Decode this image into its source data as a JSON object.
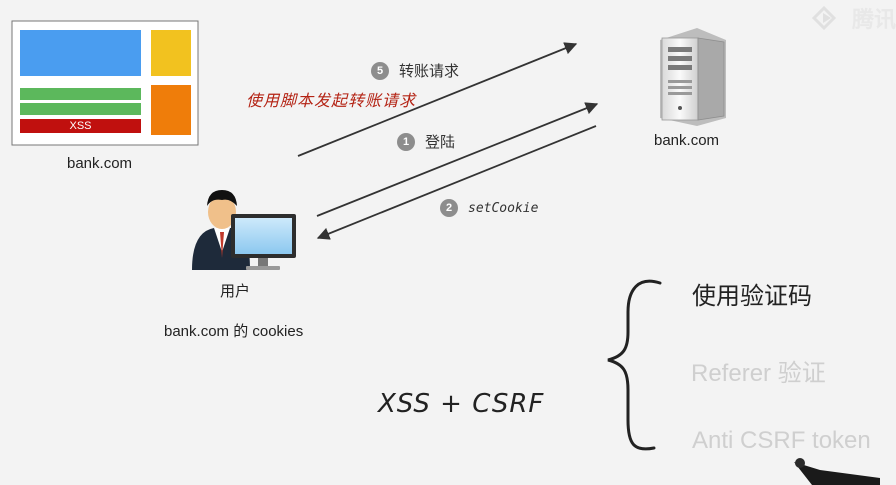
{
  "website": {
    "domain": "bank.com",
    "xss_label": "XSS"
  },
  "server": {
    "domain": "bank.com"
  },
  "user": {
    "label": "用户",
    "cookies": "bank.com 的 cookies"
  },
  "steps": [
    {
      "num": "5",
      "label": "转账请求"
    },
    {
      "num": "1",
      "label": "登陆"
    },
    {
      "num": "2",
      "label": "setCookie"
    }
  ],
  "annotation": "使用脚本发起转账请求",
  "formula": "XSS + CSRF",
  "defenses": [
    {
      "label": "使用验证码",
      "state": "active"
    },
    {
      "label": "Referer 验证",
      "state": "dim"
    },
    {
      "label": "Anti CSRF token",
      "state": "dim"
    }
  ],
  "watermark": "腾讯",
  "colors": {
    "site_blue": "#4a9df0",
    "site_green": "#5cb85c",
    "site_red": "#c0100e",
    "site_yellow": "#f2c21f",
    "site_orange": "#ef7d0a",
    "annotation_red": "#b42314",
    "arrow": "#333333"
  }
}
